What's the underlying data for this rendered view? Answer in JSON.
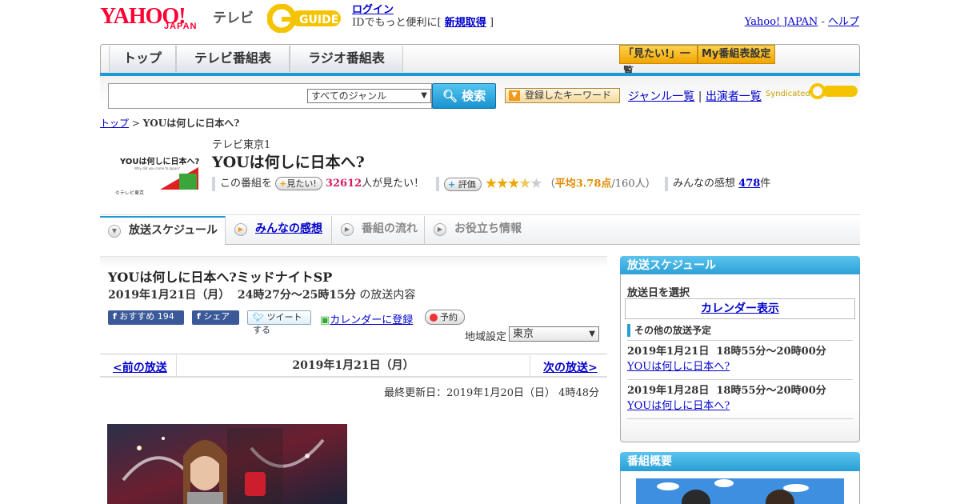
{
  "header": {
    "logo_yahoo": "YAHOO!",
    "logo_japan": "JAPAN",
    "logo_tv": "テレビ",
    "logo_gguide": "GUIDE",
    "login": "ログイン",
    "login_sub_prefix": "IDでもっと便利に[",
    "signup": "新規取得",
    "login_sub_suffix": "]",
    "yahoo_japan_link": "Yahoo! JAPAN",
    "sep": " - ",
    "help_link": "ヘルプ"
  },
  "nav": {
    "tabs": [
      "トップ",
      "テレビ番組表",
      "ラジオ番組表"
    ],
    "want_list": "「見たい!」一覧",
    "my_settings": "My番組表設定"
  },
  "search": {
    "placeholder": "",
    "genre_selected": "すべてのジャンル",
    "button": "検索",
    "keyword_button": "登録したキーワード",
    "genre_list": "ジャンル一覧",
    "divider": "|",
    "performers": "出演者一覧",
    "syndicated": "Syndicated"
  },
  "breadcrumb": {
    "top": "トップ",
    "separator": " > ",
    "current": "YOUは何しに日本へ?"
  },
  "program": {
    "thumb_title": "YOUは何しに日本へ?",
    "thumb_sub": "Why did you come to Japan?",
    "thumb_copyright": "©テレビ東京",
    "channel": "テレビ東京1",
    "title": "YOUは何しに日本へ?",
    "this_show": "この番組を",
    "want_button": "見たい!",
    "want_count": "32612",
    "want_suffix": "人が見たい！",
    "rate_button": "評価",
    "rating_stars": 3.78,
    "rating_open": "（",
    "rating_avg_label": "平均3.78点",
    "rating_count": "/160人）",
    "impressions_label": "みんなの感想",
    "impressions_count": "478",
    "impressions_suffix": "件"
  },
  "subtabs": [
    {
      "label": "放送スケジュール"
    },
    {
      "label": "みんなの感想"
    },
    {
      "label": "番組の流れ"
    },
    {
      "label": "お役立ち情報"
    }
  ],
  "episode": {
    "title": "YOUは何しに日本へ?ミッドナイトSP",
    "datetime": "2019年1月21日（月）  24時27分～25時15分",
    "datetime_suffix": "の放送内容",
    "fb_recommend": "おすすめ",
    "fb_count": "194",
    "fb_share": "シェア",
    "tweet": "ツイートする",
    "calendar": "カレンダーに登録",
    "reserve": "予約",
    "region_label": "地域設定",
    "region_selected": "東京",
    "prev": "<前の放送",
    "day": "2019年1月21日（月）",
    "next": "次の放送>",
    "updated": "最終更新日：2019年1月20日（日） 4時48分"
  },
  "sidebar": {
    "schedule_title": "放送スケジュール",
    "select_date": "放送日を選択",
    "calendar_button": "カレンダー表示",
    "other_schedule": "その他の放送予定",
    "items": [
      {
        "time": "2019年1月21日  18時55分～20時00分",
        "title": "YOUは何しに日本へ?"
      },
      {
        "time": "2019年1月28日  18時55分～20時00分",
        "title": "YOUは何しに日本へ?"
      }
    ],
    "overview_title": "番組概要"
  },
  "colors": {
    "accent_blue": "#1a9ad6",
    "yahoo_red": "#ff0033",
    "orange": "#f0a500"
  }
}
